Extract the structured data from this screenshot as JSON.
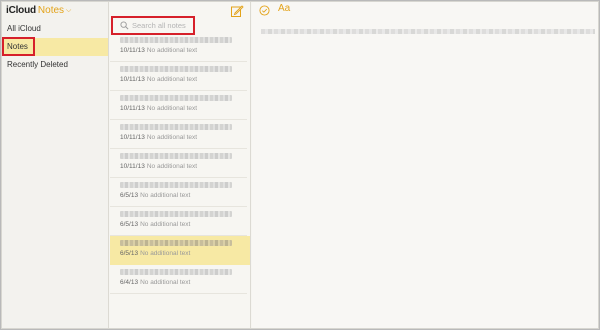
{
  "sidebar": {
    "app_name": "iCloud",
    "section_label": "Notes",
    "items": [
      {
        "label": "All iCloud"
      },
      {
        "label": "Notes"
      },
      {
        "label": "Recently Deleted"
      }
    ]
  },
  "list": {
    "search_placeholder": "Search all notes",
    "notes": [
      {
        "date": "10/11/13",
        "preview": "No additional text"
      },
      {
        "date": "10/11/13",
        "preview": "No additional text"
      },
      {
        "date": "10/11/13",
        "preview": "No additional text"
      },
      {
        "date": "10/11/13",
        "preview": "No additional text"
      },
      {
        "date": "10/11/13",
        "preview": "No additional text"
      },
      {
        "date": "6/5/13",
        "preview": "No additional text"
      },
      {
        "date": "6/5/13",
        "preview": "No additional text"
      },
      {
        "date": "6/5/13",
        "preview": "No additional text"
      },
      {
        "date": "6/4/13",
        "preview": "No additional text"
      }
    ]
  },
  "editor": {
    "font_button_label": "Aa"
  },
  "colors": {
    "accent": "#e3a31a",
    "selection": "#f7e9a4",
    "highlight_box": "#d6202a"
  }
}
